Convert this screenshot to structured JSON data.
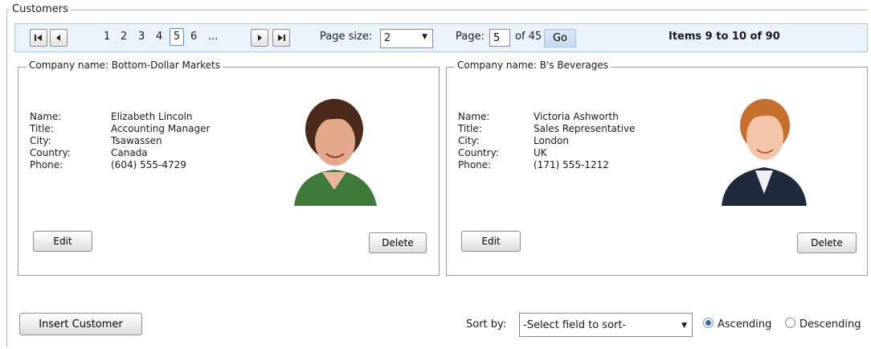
{
  "group_title": "Customers",
  "pager": {
    "pages": [
      "1",
      "2",
      "3",
      "4",
      "5",
      "6",
      "..."
    ],
    "page_size_label": "Page size:",
    "page_size_value": "2",
    "page_label": "Page:",
    "page_value": "5",
    "of_label": "of 45",
    "go_label": "Go",
    "items_info": "Items 9 to 10 of 90"
  },
  "cards": [
    {
      "legend": "Company name: Bottom-Dollar Markets",
      "name_label": "Name:",
      "name": "Elizabeth Lincoln",
      "title_label": "Title:",
      "title": "Accounting Manager",
      "city_label": "City:",
      "city": "Tsawassen",
      "country_label": "Country:",
      "country": "Canada",
      "phone_label": "Phone:",
      "phone": "(604) 555-4729",
      "edit_label": "Edit",
      "delete_label": "Delete"
    },
    {
      "legend": "Company name: B's Beverages",
      "name_label": "Name:",
      "name": "Victoria Ashworth",
      "title_label": "Title:",
      "title": "Sales Representative",
      "city_label": "City:",
      "city": "London",
      "country_label": "Country:",
      "country": "UK",
      "phone_label": "Phone:",
      "phone": "(171) 555-1212",
      "edit_label": "Edit",
      "delete_label": "Delete"
    }
  ],
  "insert_label": "Insert Customer",
  "sort": {
    "label": "Sort by:",
    "placeholder": "-Select field to sort-",
    "ascending": "Ascending",
    "descending": "Descending",
    "selected": "Ascending"
  }
}
